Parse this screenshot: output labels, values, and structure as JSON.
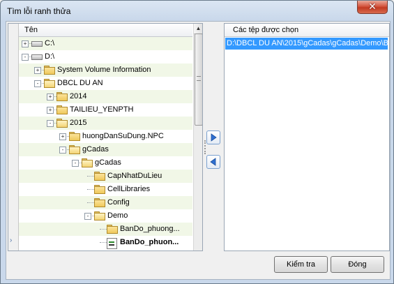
{
  "window": {
    "title": "Tìm lỗi ranh thửa",
    "close_glyph": "✕"
  },
  "tree": {
    "column_header": "Tên",
    "gutter_glyph": "›",
    "rows": [
      {
        "label": "C:\\",
        "icon": "drive-icon",
        "expander": "+"
      },
      {
        "label": "D:\\",
        "icon": "drive-icon",
        "expander": "−"
      },
      {
        "label": "System Volume Information",
        "icon": "folder-icon",
        "expander": "+"
      },
      {
        "label": "DBCL DU AN",
        "icon": "folder-open-icon",
        "expander": "−"
      },
      {
        "label": "2014",
        "icon": "folder-icon",
        "expander": "+"
      },
      {
        "label": "TAILIEU_YENPTH",
        "icon": "folder-icon",
        "expander": "+"
      },
      {
        "label": "2015",
        "icon": "folder-open-icon",
        "expander": "−"
      },
      {
        "label": "huongDanSuDung.NPC",
        "icon": "folder-icon",
        "expander": "+"
      },
      {
        "label": "gCadas",
        "icon": "folder-open-icon",
        "expander": "−"
      },
      {
        "label": "gCadas",
        "icon": "folder-open-icon",
        "expander": "−"
      },
      {
        "label": "CapNhatDuLieu",
        "icon": "folder-icon",
        "expander": ""
      },
      {
        "label": "CellLibraries",
        "icon": "folder-icon",
        "expander": ""
      },
      {
        "label": "Config",
        "icon": "folder-icon",
        "expander": ""
      },
      {
        "label": "Demo",
        "icon": "folder-open-icon",
        "expander": "−"
      },
      {
        "label": "BanDo_phuong...",
        "icon": "folder-icon",
        "expander": ""
      },
      {
        "label": "BanDo_phuon...",
        "icon": "file-icon",
        "expander": ""
      }
    ]
  },
  "right": {
    "column_header": "Các tệp được chọn",
    "selected_items": [
      "D:\\DBCL DU AN\\2015\\gCadas\\gCadas\\Demo\\Ba"
    ]
  },
  "buttons": {
    "check": "Kiểm tra",
    "close": "Đóng"
  },
  "colors": {
    "selection": "#3399ff",
    "alt_row": "#f1f7e7",
    "arrow_blue": "#2f6fd1"
  }
}
